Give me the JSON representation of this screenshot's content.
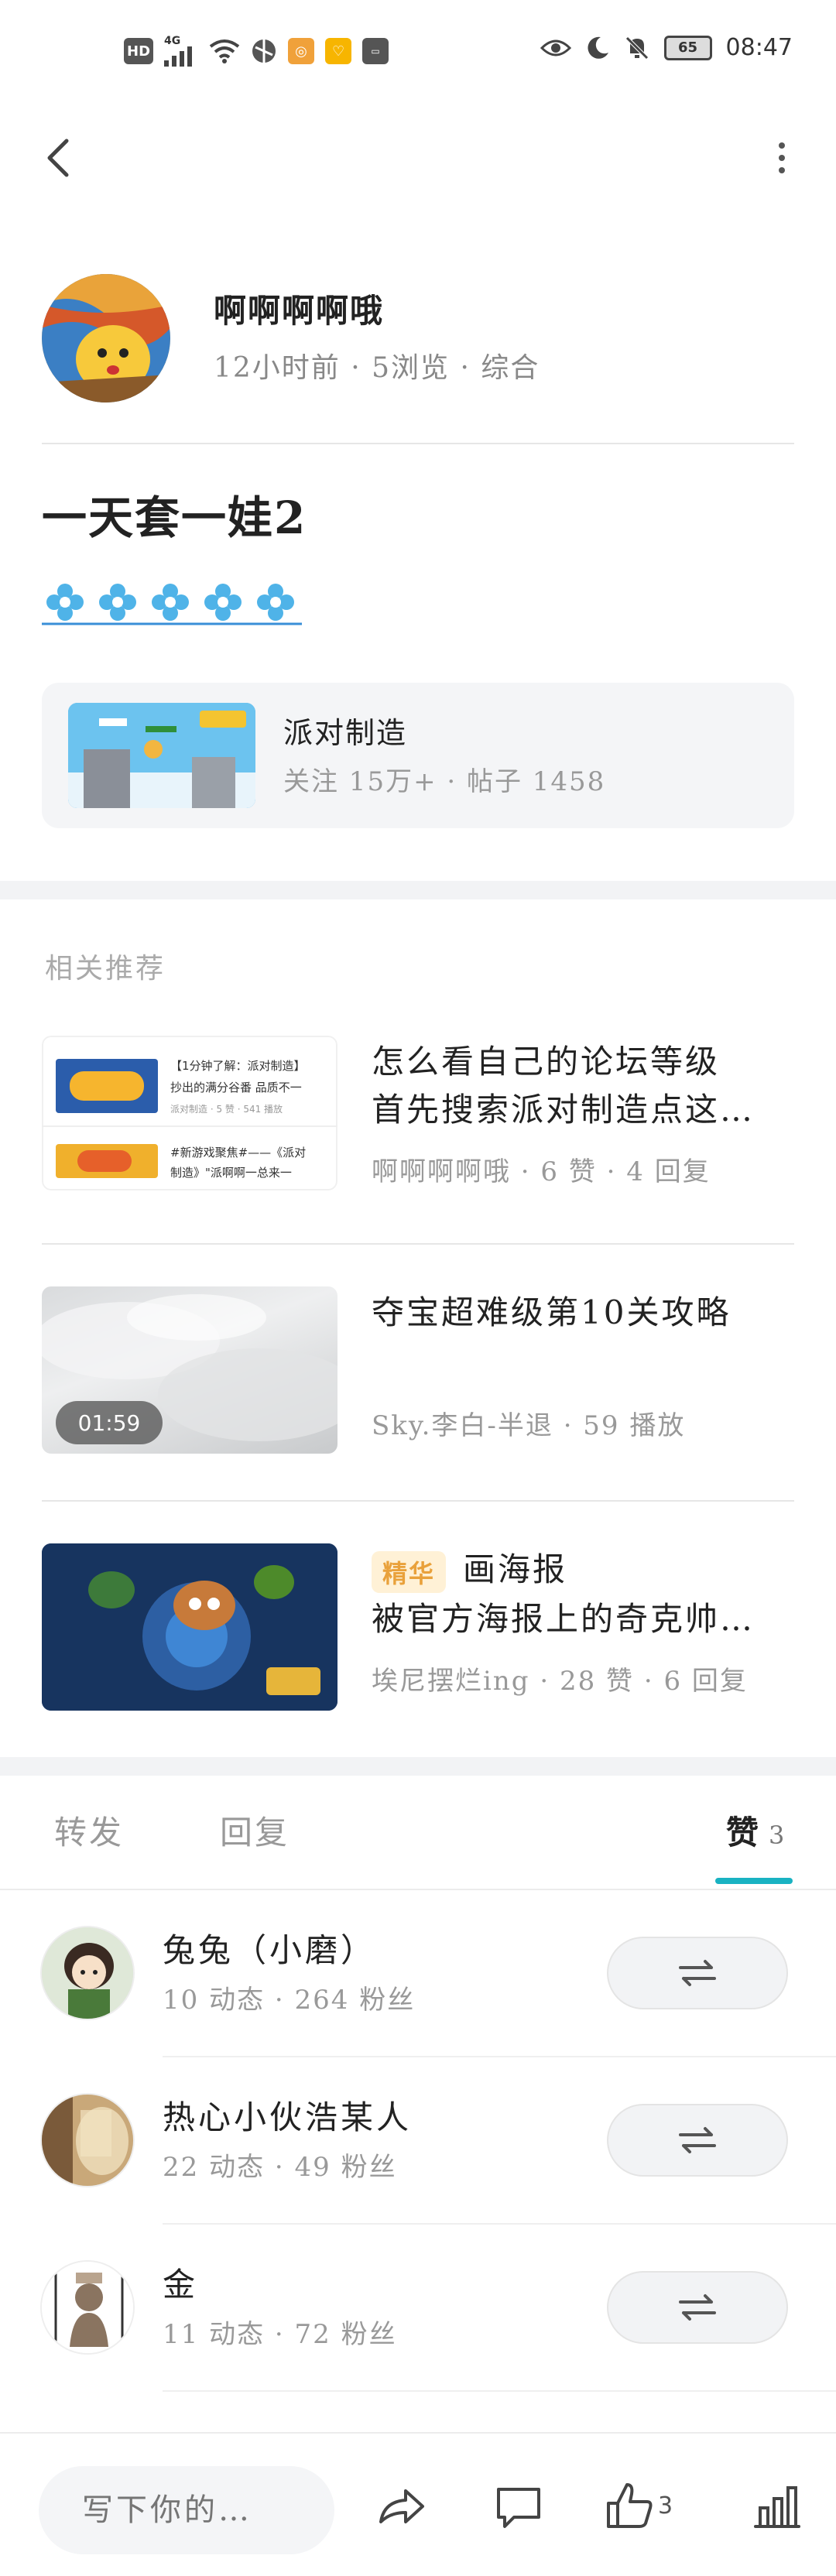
{
  "status_bar": {
    "left_chips": [
      "HD",
      "4G"
    ],
    "time": "08:47",
    "battery": "65"
  },
  "author": {
    "name": "啊啊啊啊哦",
    "meta": "12小时前 · 5浏览 · 综合"
  },
  "post": {
    "title": "一天套一娃2"
  },
  "game_card": {
    "name": "派对制造",
    "meta": "关注 15万+ · 帖子 1458"
  },
  "recommend": {
    "title": "相关推荐",
    "items": [
      {
        "line1": "怎么看自己的论坛等级",
        "line2": "首先搜索派对制造点这…",
        "meta": "啊啊啊啊哦 · 6 赞 · 4 回复",
        "thumb_text1": "【1分钟了解：派对制造】",
        "thumb_text2": "抄出的满分谷番 品质不一",
        "thumb_text3": "派对制造 · 5 赞 · 541 播放",
        "thumb_text4": "#新游戏聚焦#——《派对",
        "thumb_text5": "制造》\"派啊啊一总来一"
      },
      {
        "line1": "夺宝超难级第10关攻略",
        "meta": "Sky.李白-半退 · 59 播放",
        "duration": "01:59"
      },
      {
        "badge": "精华",
        "line1": "画海报",
        "line2": "被官方海报上的奇克帅…",
        "meta": "埃尼摆烂ing · 28 赞 · 6 回复"
      }
    ]
  },
  "tabs": {
    "repost": "转发",
    "reply": "回复",
    "like": "赞",
    "like_count": "3"
  },
  "users": [
    {
      "name": "兔兔（小磨）",
      "meta": "10 动态 · 264 粉丝"
    },
    {
      "name": "热心小伙浩某人",
      "meta": "22 动态 · 49 粉丝"
    },
    {
      "name": "金",
      "meta": "11 动态 · 72 粉丝"
    }
  ],
  "bottom_bar": {
    "placeholder": "写下你的…",
    "like_count": "3"
  },
  "colors": {
    "accent": "#19b2c2",
    "badge_bg": "#fff1d6",
    "badge_text": "#e9a13b",
    "muted_text": "#999999"
  }
}
